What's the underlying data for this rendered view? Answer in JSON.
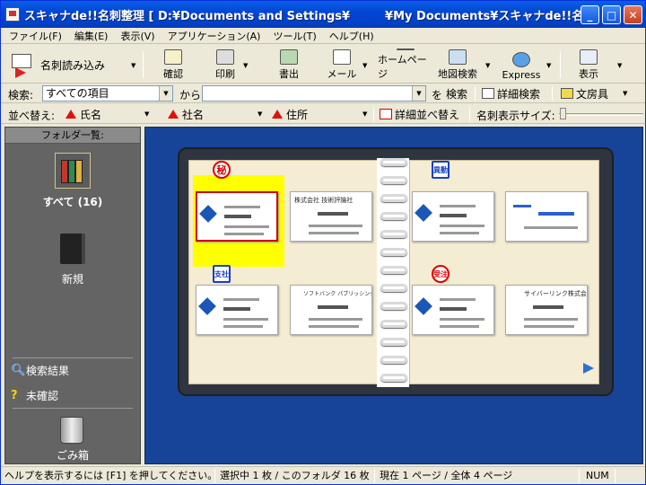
{
  "window": {
    "title": "スキャナde!!名刺整理 [ D:¥Documents and Settings¥　　　¥My Documents¥スキャナde!!名刺整理..."
  },
  "menu": [
    "ファイル(F)",
    "編集(E)",
    "表示(V)",
    "アプリケーション(A)",
    "ツール(T)",
    "ヘルプ(H)"
  ],
  "toolbar": {
    "scan": "名刺読み込み",
    "confirm": "確認",
    "print": "印刷",
    "export": "書出",
    "mail": "メール",
    "homepage": "ホームページ",
    "map": "地図検索",
    "express": "Express",
    "view": "表示"
  },
  "search": {
    "label": "検索:",
    "field_value": "すべての項目",
    "from_label": "から",
    "query": "",
    "suffix_label": "を",
    "search_button": "検索",
    "detail_button": "詳細検索",
    "stationery_button": "文房具"
  },
  "sort": {
    "label": "並べ替え:",
    "keys": [
      "氏名",
      "社名",
      "住所"
    ],
    "detail_button": "詳細並べ替え",
    "size_label": "名刺表示サイズ:"
  },
  "sidebar": {
    "header": "フォルダ一覧:",
    "folders": [
      {
        "label": "すべて (16)"
      },
      {
        "label": "新規"
      }
    ],
    "links": {
      "search_results": "検索結果",
      "unconfirmed": "未確認",
      "trash": "ごみ箱"
    }
  },
  "cards": {
    "stamps": {
      "secret": "秘",
      "transfer": "異動",
      "branch": "支社",
      "other": "受注"
    },
    "companies": {
      "card2": "株式会社 技術評論社",
      "card6": "ソフトバンク パブリッシング株式会社",
      "card8": "サイバーリンク株式会社"
    }
  },
  "status": {
    "help": "ヘルプを表示するには [F1] を押してください。",
    "selection": "選択中 1 枚 / このフォルダ 16 枚",
    "page": "現在 1 ページ / 全体 4 ページ",
    "num": "NUM"
  }
}
